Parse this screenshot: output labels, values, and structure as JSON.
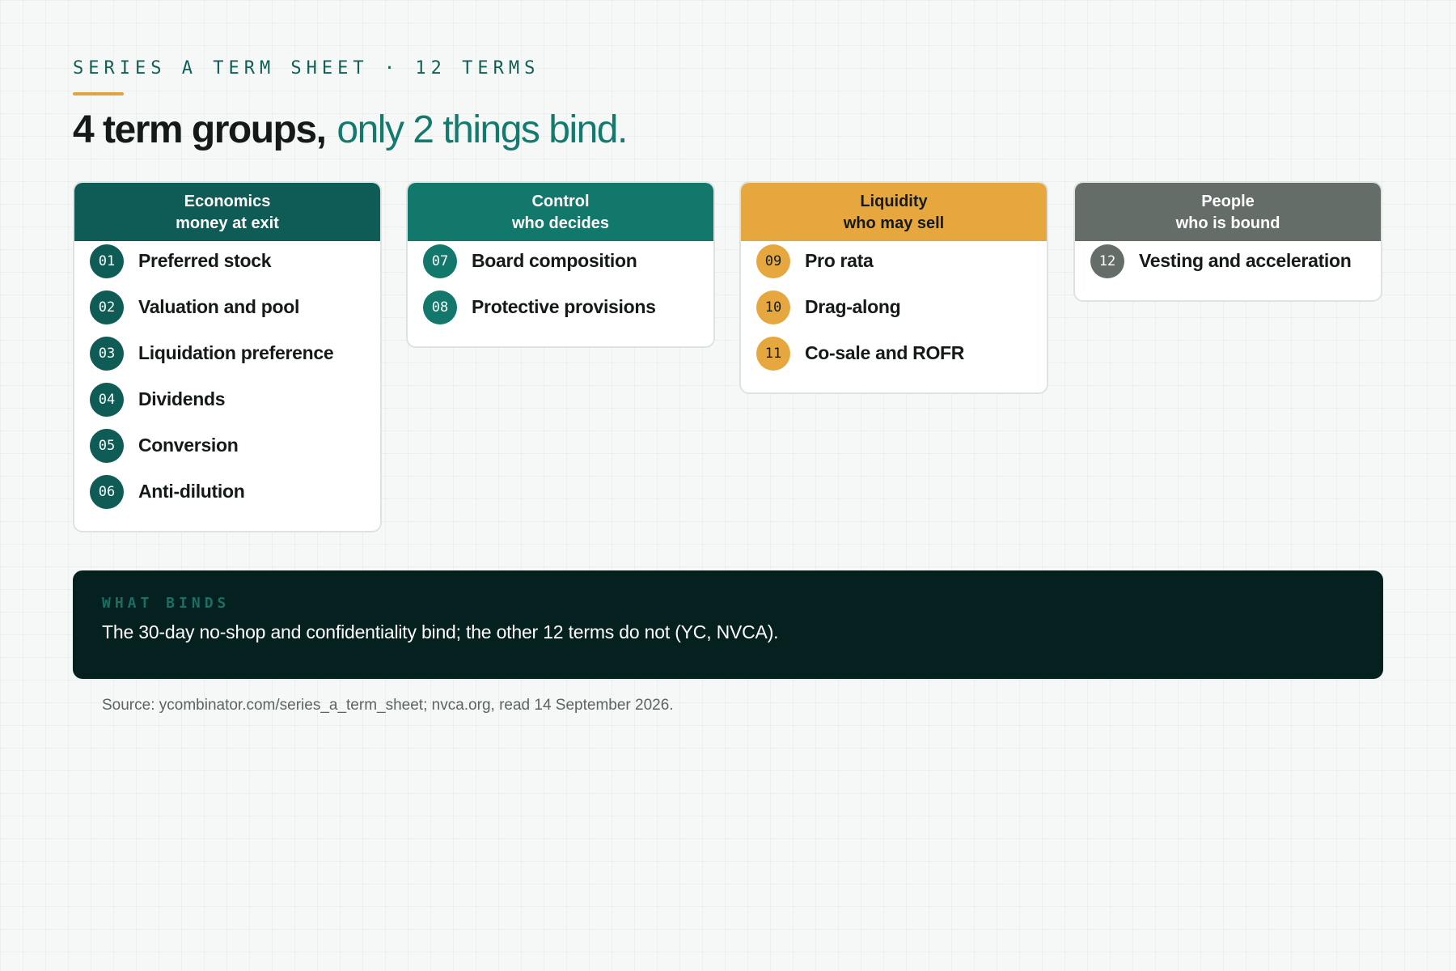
{
  "eyebrow": "SERIES A TERM SHEET · 12 TERMS",
  "headline": {
    "strong": "4 term groups,",
    "accent": "only 2 things bind."
  },
  "colors": {
    "economics": "#0e5c55",
    "control": "#13786c",
    "liquidity": "#e6a83e",
    "people": "#646d68",
    "eyebrow_rule": "#e0a43c",
    "callout_bg": "#05211f"
  },
  "groups": [
    {
      "name": "Economics",
      "subtitle": "money at exit",
      "terms": [
        {
          "num": "01",
          "label": "Preferred stock"
        },
        {
          "num": "02",
          "label": "Valuation and pool"
        },
        {
          "num": "03",
          "label": "Liquidation preference"
        },
        {
          "num": "04",
          "label": "Dividends"
        },
        {
          "num": "05",
          "label": "Conversion"
        },
        {
          "num": "06",
          "label": "Anti-dilution"
        }
      ]
    },
    {
      "name": "Control",
      "subtitle": "who decides",
      "terms": [
        {
          "num": "07",
          "label": "Board composition"
        },
        {
          "num": "08",
          "label": "Protective provisions"
        }
      ]
    },
    {
      "name": "Liquidity",
      "subtitle": "who may sell",
      "terms": [
        {
          "num": "09",
          "label": "Pro rata"
        },
        {
          "num": "10",
          "label": "Drag-along"
        },
        {
          "num": "11",
          "label": "Co-sale and ROFR"
        }
      ]
    },
    {
      "name": "People",
      "subtitle": "who is bound",
      "terms": [
        {
          "num": "12",
          "label": "Vesting and acceleration"
        }
      ]
    }
  ],
  "callout": {
    "kicker": "WHAT BINDS",
    "text": "The 30-day no-shop and confidentiality bind; the other 12 terms do not (YC, NVCA)."
  },
  "source": "Source: ycombinator.com/series_a_term_sheet; nvca.org, read 14 September 2026."
}
